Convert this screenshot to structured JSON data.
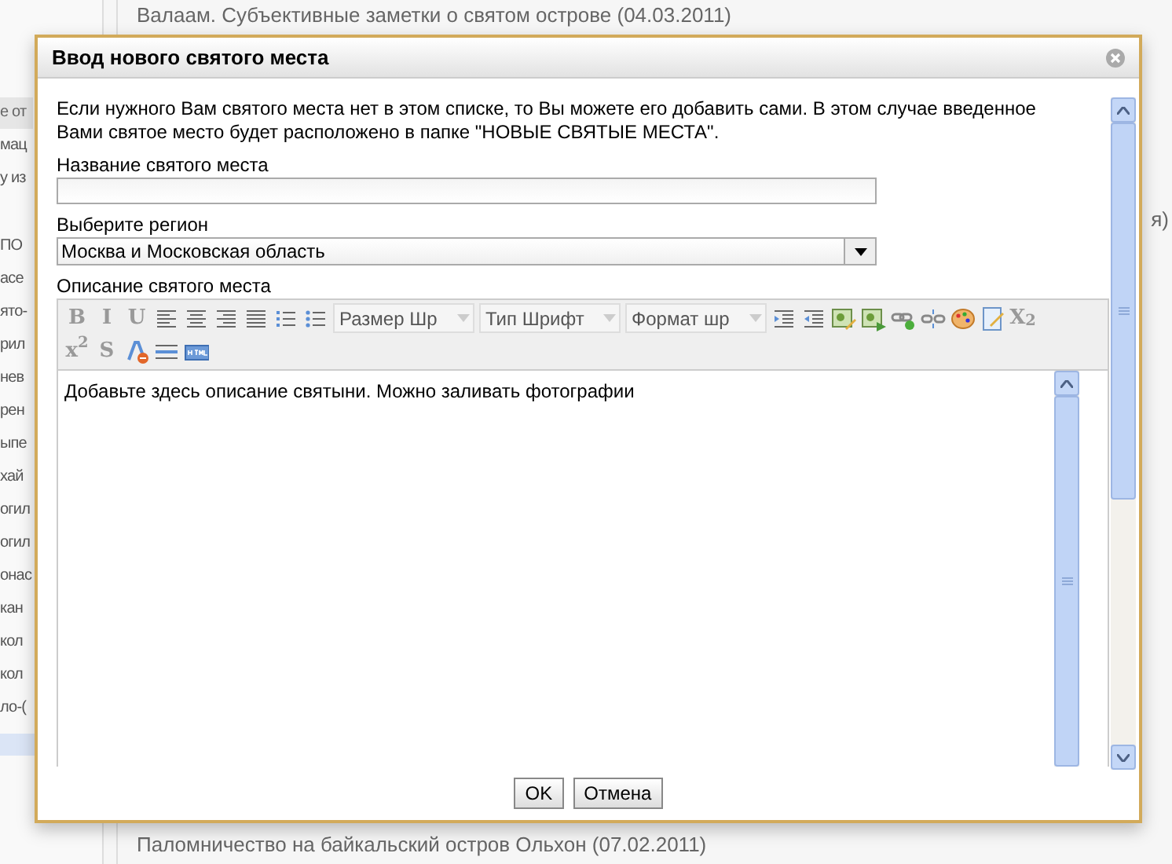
{
  "background": {
    "header_fragment": "е от",
    "top_lines": [
      "Валаам. Субъективные заметки о святом острове (04.03.2011)"
    ],
    "left_fragments": [
      "мац",
      "у из",
      "ПО",
      "асе",
      "ято-",
      "рил",
      "нев",
      "рен",
      "ыпе",
      "хай",
      "огил",
      "огил",
      "онас",
      "кан",
      "кол",
      "кол",
      "ло-("
    ],
    "right_fragment": "я)",
    "bottom_lines": [
      "Паломничество на байкальский остров Ольхон (07.02.2011)"
    ]
  },
  "dialog": {
    "title": "Ввод нового святого места",
    "intro": "Если нужного Вам святого места нет в этом списке, то Вы можете его добавить сами. В этом случае введенное Вами святое место будет расположено в папке \"НОВЫЕ СВЯТЫЕ МЕСТА\".",
    "name_label": "Название святого места",
    "region_label": "Выберите регион",
    "region_value": "Москва и Московская область",
    "description_label": "Описание святого места",
    "toolbar_rows": [
      [
        {
          "kind": "glyph",
          "label": "B"
        },
        {
          "kind": "glyph",
          "label": "I"
        },
        {
          "kind": "glyph",
          "label": "U"
        },
        {
          "kind": "align-left"
        },
        {
          "kind": "align-center"
        },
        {
          "kind": "align-right"
        },
        {
          "kind": "justify"
        },
        {
          "kind": "ordered-list"
        },
        {
          "kind": "bullet-list"
        },
        {
          "kind": "dropdown",
          "label": "Размер Шр"
        },
        {
          "kind": "dropdown",
          "label": "Тип Шрифт"
        },
        {
          "kind": "dropdown",
          "label": "Формат шр"
        },
        {
          "kind": "indent"
        },
        {
          "kind": "outdent"
        },
        {
          "kind": "image-edit"
        },
        {
          "kind": "image-insert"
        },
        {
          "kind": "link"
        },
        {
          "kind": "unlink"
        },
        {
          "kind": "palette"
        },
        {
          "kind": "document-edit"
        },
        {
          "kind": "glyph",
          "label": "X$_{2}$"
        }
      ],
      [
        {
          "kind": "glyph",
          "label": "x$^{2}$"
        },
        {
          "kind": "glyph",
          "label": "S"
        },
        {
          "kind": "clear-format"
        },
        {
          "kind": "rule"
        },
        {
          "kind": "html"
        }
      ]
    ],
    "editor_text": "Добавьте здесь описание святыни. Можно заливать фотографии",
    "buttons": [
      "OK",
      "Отмена"
    ]
  }
}
